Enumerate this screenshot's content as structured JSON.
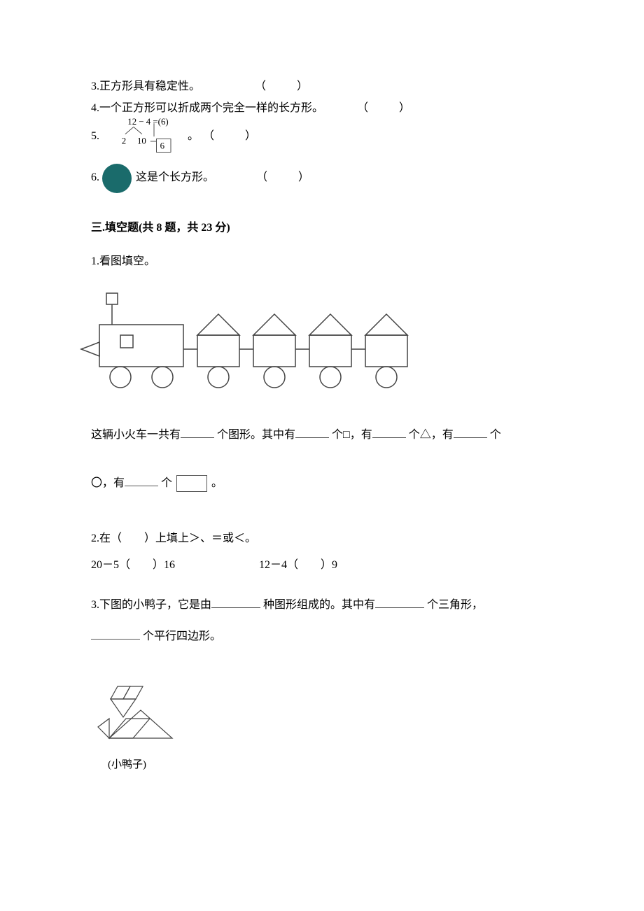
{
  "tf": {
    "q3": "3.正方形具有稳定性。",
    "q4": "4.一个正方形可以折成两个完全一样的长方形。",
    "q5_prefix": "5.",
    "q5_eq": "12 − 4 =(6)",
    "q5_left": "2",
    "q5_right": "10",
    "q5_box": "6",
    "q5_suffix": "。",
    "q6_prefix": "6.",
    "q6_text": "这是个长方形。",
    "paren": "（　　）"
  },
  "secThree": {
    "head": "三.填空题(共 8 题，共 23 分)"
  },
  "fill": {
    "q1_title": "1.看图填空。",
    "q1_a": "这辆小火车一共有",
    "q1_b": "个图形。其中有",
    "q1_c": "个□，有",
    "q1_d": "个△，有",
    "q1_e": "个",
    "q1_f": "〇，有",
    "q1_g": "个",
    "q1_period": "。",
    "q2_title": "2.在（　　）上填上＞、＝或＜。",
    "q2_a": "20－5（　　）16",
    "q2_b": "12－4（　　）9",
    "q3_a": "3.下图的小鸭子，它是由",
    "q3_b": "种图形组成的。其中有",
    "q3_c": "个三角形，",
    "q3_d": "个平行四边形。",
    "duck_caption": "(小鸭子)"
  }
}
